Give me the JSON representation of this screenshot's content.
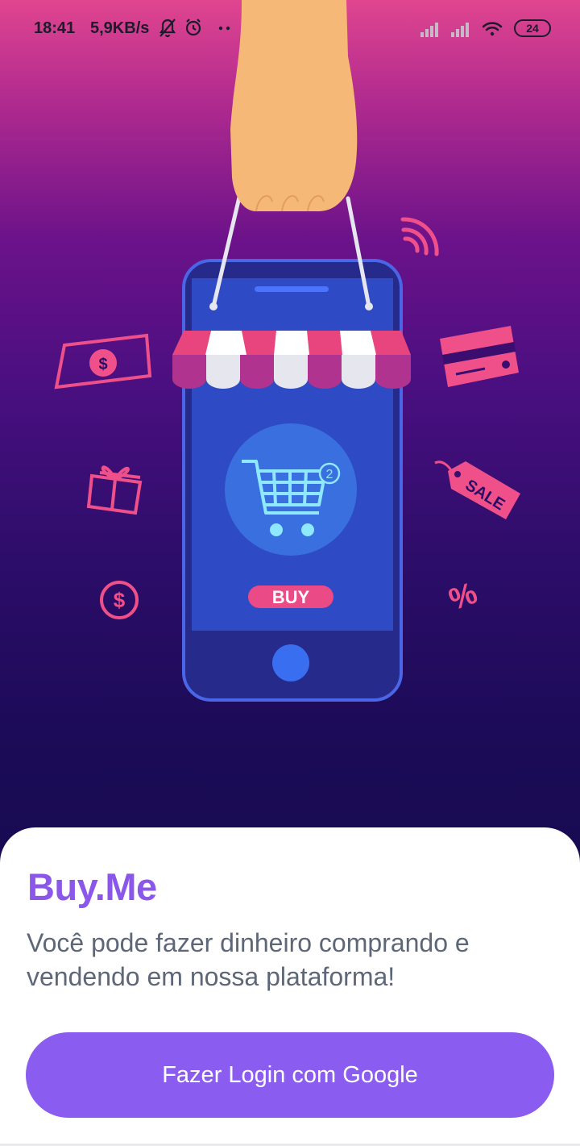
{
  "status_bar": {
    "time": "18:41",
    "network_speed": "5,9KB/s",
    "battery_level": "24",
    "icons": [
      "bell-off-icon",
      "alarm-icon",
      "more-dots-icon",
      "signal-icon",
      "signal-icon",
      "wifi-icon",
      "battery-icon"
    ]
  },
  "hero": {
    "cart_badge": "2",
    "buy_label": "BUY",
    "sale_tag": "SALE",
    "percent": "%",
    "dollar": "$",
    "colors": {
      "accent": "#e8457f",
      "phone_body": "#2a2d8a",
      "phone_screen": "#2f4dc4",
      "cart_circle": "#3a6fe0"
    }
  },
  "sheet": {
    "title": "Buy.Me",
    "description": "Você pode fazer dinheiro comprando e vendendo em nossa plataforma!",
    "login_button": "Fazer Login com Google",
    "colors": {
      "primary": "#8b5cf0",
      "text": "#5d6777"
    }
  }
}
